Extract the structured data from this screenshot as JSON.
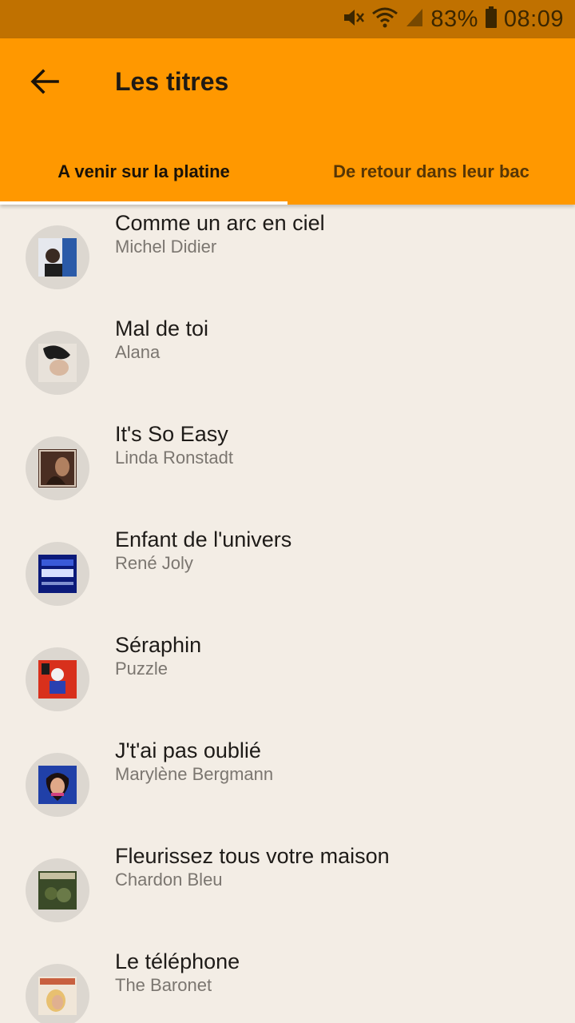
{
  "status_bar": {
    "battery": "83%",
    "time": "08:09",
    "icons": [
      "mute-icon",
      "wifi-icon",
      "signal-icon",
      "battery-icon"
    ]
  },
  "app_bar": {
    "title": "Les titres",
    "back_icon": "arrow-back-icon",
    "color": "#ff9800"
  },
  "tabs": [
    {
      "label": "A venir sur la platine",
      "selected": true
    },
    {
      "label": "De retour dans leur bac",
      "selected": false
    }
  ],
  "tracks": [
    {
      "title": "Comme un arc en ciel",
      "artist": "Michel Didier",
      "cover_colors": [
        "#2a5aa8",
        "#e6e8ee"
      ]
    },
    {
      "title": "Mal de toi",
      "artist": "Alana",
      "cover_colors": [
        "#e8e2da",
        "#1c1c1c"
      ]
    },
    {
      "title": "It's So Easy",
      "artist": "Linda Ronstadt",
      "cover_colors": [
        "#4a2e22",
        "#b08060"
      ]
    },
    {
      "title": "Enfant de l'univers",
      "artist": "René Joly",
      "cover_colors": [
        "#0b1a7a",
        "#d8e0ff"
      ]
    },
    {
      "title": "Séraphin",
      "artist": "Puzzle",
      "cover_colors": [
        "#d8301c",
        "#f2f2f2"
      ]
    },
    {
      "title": "J't'ai pas oublié",
      "artist": "Marylène Bergmann",
      "cover_colors": [
        "#2040a8",
        "#d04080"
      ]
    },
    {
      "title": "Fleurissez tous votre maison",
      "artist": "Chardon Bleu",
      "cover_colors": [
        "#3a4a28",
        "#c6c0a0"
      ]
    },
    {
      "title": "Le téléphone",
      "artist": "The Baronet",
      "cover_colors": [
        "#f0e6d8",
        "#c86040"
      ]
    }
  ]
}
